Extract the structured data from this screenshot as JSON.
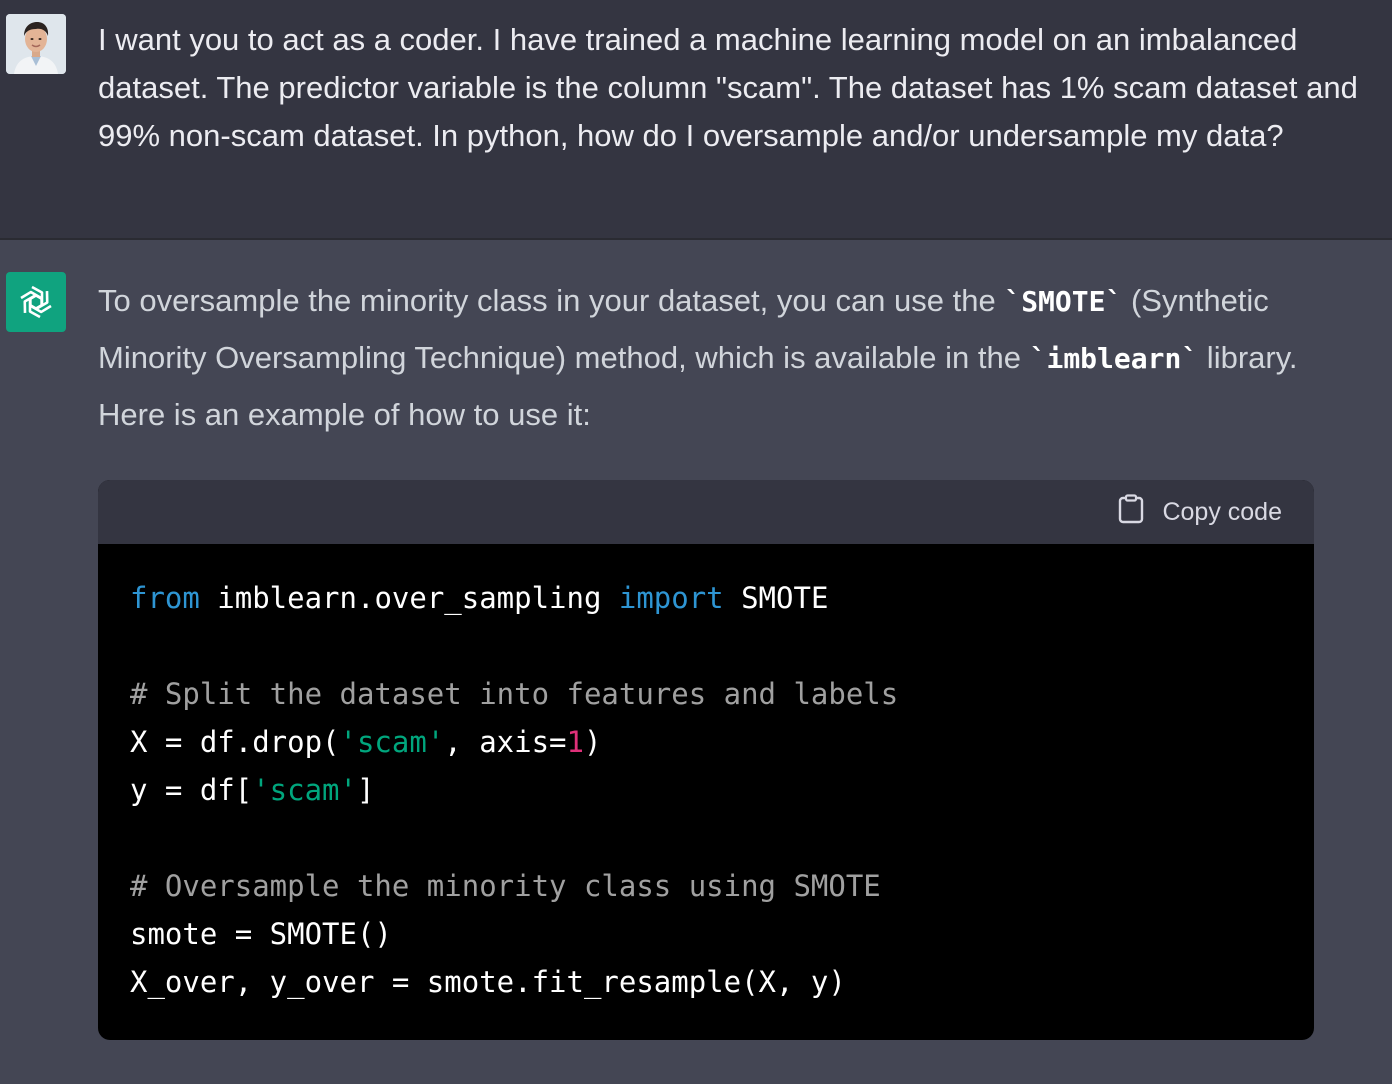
{
  "user_message": {
    "text": "I want you to act as a coder. I have trained a machine learning model on an imbalanced dataset. The predictor variable is the column \"scam\". The dataset has 1% scam dataset and 99% non-scam dataset. In python, how do I oversample and/or undersample my data?"
  },
  "assistant_message": {
    "intro_part1": "To oversample the minority class in your dataset, you can use the ",
    "code_smote": "`SMOTE`",
    "intro_part2": " (Synthetic Minority Oversampling Technique) method, which is available in the ",
    "code_imblearn": "`imblearn`",
    "intro_part3": " library. Here is an example of how to use it:"
  },
  "code_block": {
    "copy_label": "Copy code",
    "lines": {
      "l1_from": "from",
      "l1_module": " imblearn.over_sampling ",
      "l1_import": "import",
      "l1_name": " SMOTE",
      "l3_comment": "# Split the dataset into features and labels",
      "l4_a": "X = df.drop(",
      "l4_str": "'scam'",
      "l4_b": ", axis=",
      "l4_num": "1",
      "l4_c": ")",
      "l5_a": "y = df[",
      "l5_str": "'scam'",
      "l5_b": "]",
      "l7_comment": "# Oversample the minority class using SMOTE",
      "l8": "smote = SMOTE()",
      "l9": "X_over, y_over = smote.fit_resample(X, y)"
    }
  },
  "colors": {
    "user_bg": "#343541",
    "assistant_bg": "#444654",
    "gpt_avatar": "#10a37f",
    "code_keyword": "#2e95d3",
    "code_string": "#00a67d",
    "code_number": "#df3079"
  },
  "icons": {
    "user_avatar": "user-photo-avatar",
    "assistant_avatar": "openai-logo-icon",
    "copy": "clipboard-icon"
  }
}
